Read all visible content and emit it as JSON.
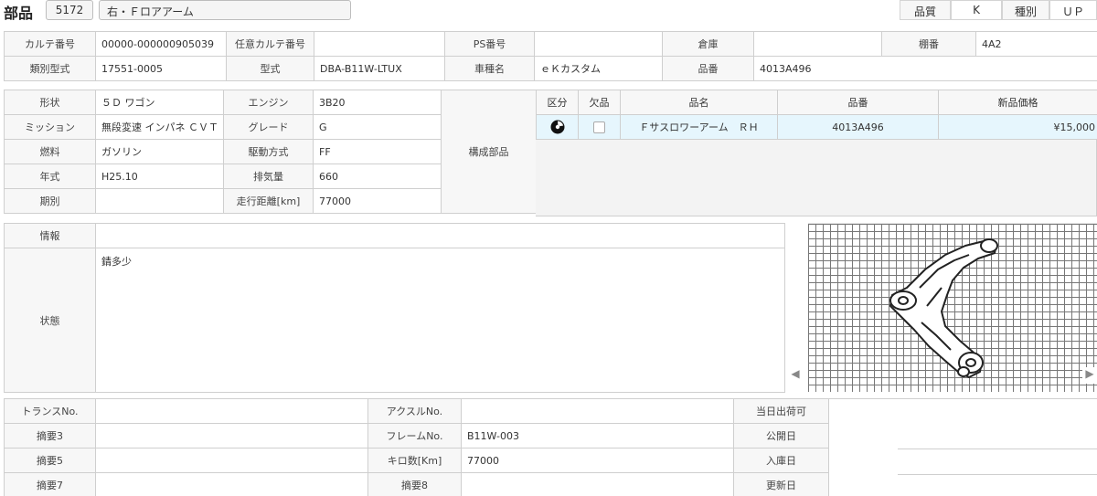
{
  "header": {
    "title": "部品",
    "part_code": "5172",
    "part_name": "右・Ｆロアアーム",
    "quality_label": "品質",
    "quality_value": "K",
    "type_label": "種別",
    "type_value": "ＵＰ"
  },
  "top": {
    "karte_no_label": "カルテ番号",
    "karte_no": "00000-000000905039",
    "any_karte_label": "任意カルテ番号",
    "any_karte": "",
    "ps_label": "PS番号",
    "ps": "",
    "warehouse_label": "倉庫",
    "warehouse": "",
    "shelf_label": "棚番",
    "shelf": "4A2",
    "class_type_label": "類別型式",
    "class_type": "17551-0005",
    "model_label": "型式",
    "model": "DBA-B11W-LTUX",
    "car_label": "車種名",
    "car": "ｅＫカスタム",
    "partno_label": "品番",
    "partno": "4013A496"
  },
  "spec": {
    "shape_label": "形状",
    "shape": "５Ｄ ワゴン",
    "engine_label": "エンジン",
    "engine": "3B20",
    "mission_label": "ミッション",
    "mission": "無段変速 インパネ ＣＶＴ",
    "grade_label": "グレード",
    "grade": "G",
    "fuel_label": "燃料",
    "fuel": "ガソリン",
    "drive_label": "駆動方式",
    "drive": "FF",
    "year_label": "年式",
    "year": "H25.10",
    "displacement_label": "排気量",
    "displacement": "660",
    "period_label": "期別",
    "period": "",
    "mileage_label": "走行距離[km]",
    "mileage": "77000",
    "components_label": "構成部品"
  },
  "parts": {
    "headers": [
      "区分",
      "欠品",
      "品名",
      "品番",
      "新品価格"
    ],
    "rows": [
      {
        "category_icon": "disc-icon",
        "missing": false,
        "name": "Ｆサスロワーアーム　ＲＨ",
        "number": "4013A496",
        "price": "¥15,000"
      }
    ]
  },
  "info": {
    "info_label": "情報",
    "info": "",
    "condition_label": "状態",
    "condition": "錆多少"
  },
  "bottom": {
    "trans_label": "トランスNo.",
    "trans": "",
    "axle_label": "アクスルNo.",
    "axle": "",
    "same_day_label": "当日出荷可",
    "same_day": "",
    "memo3_label": "摘要3",
    "memo3": "",
    "frame_label": "フレームNo.",
    "frame": "B11W-003",
    "published_label": "公開日",
    "published": "",
    "memo5_label": "摘要5",
    "memo5": "",
    "km_label": "キロ数[Km]",
    "km": "77000",
    "arrival_label": "入庫日",
    "arrival": "",
    "memo7_label": "摘要7",
    "memo7": "",
    "memo8_label": "摘要8",
    "memo8": "",
    "updated_label": "更新日",
    "updated": ""
  },
  "image_nav": {
    "prev": "◀",
    "next": "▶"
  }
}
